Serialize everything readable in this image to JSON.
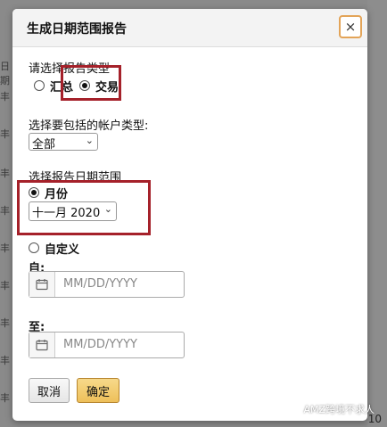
{
  "dialog": {
    "title": "生成日期范围报告",
    "close_label": "×"
  },
  "report_type": {
    "label": "请选择报告类型",
    "options": [
      {
        "label": "汇总",
        "selected": false
      },
      {
        "label": "交易",
        "selected": true
      }
    ]
  },
  "account_type": {
    "label": "选择要包括的帐户类型:",
    "selected": "全部"
  },
  "date_range": {
    "label": "选择报告日期范围",
    "month_option": {
      "label": "月份",
      "selected": true
    },
    "month_value": "十一月 2020",
    "custom_option": {
      "label": "自定义",
      "selected": false
    },
    "from_label": "自:",
    "from_placeholder": "MM/DD/YYYY",
    "to_label": "至:",
    "to_placeholder": "MM/DD/YYYY"
  },
  "buttons": {
    "cancel": "取消",
    "ok": "确定"
  },
  "background": {
    "row_glyph": "丰",
    "partial_header": "日期",
    "corner_number": "10"
  },
  "watermark": "AMZ跨境不求人",
  "colors": {
    "highlight": "#a5212a",
    "ok_button": "#eec05a",
    "close_border": "#e3a458"
  }
}
